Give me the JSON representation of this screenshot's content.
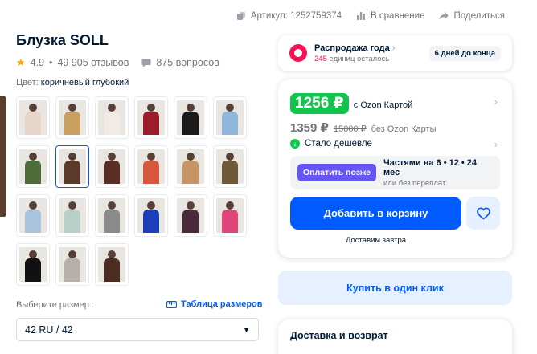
{
  "topbar": {
    "article": "Артикул: 1252759374",
    "compare": "В сравнение",
    "share": "Поделиться"
  },
  "product": {
    "title": "Блузка SOLL",
    "rating": "4.9",
    "reviews": "49 905 отзывов",
    "questions": "875 вопросов",
    "color_label": "Цвет:",
    "color_value": "коричневый глубокий"
  },
  "thumbnails": [
    {
      "name": "variant-1",
      "color": "#e6d5c8"
    },
    {
      "name": "variant-2",
      "color": "#c9a060"
    },
    {
      "name": "variant-3",
      "color": "#f0ebe4"
    },
    {
      "name": "variant-4",
      "color": "#9c1c2c"
    },
    {
      "name": "variant-5",
      "color": "#1a1a1a"
    },
    {
      "name": "variant-6",
      "color": "#8fb8dc"
    },
    {
      "name": "variant-7",
      "color": "#4e6b3a"
    },
    {
      "name": "variant-8",
      "color": "#5a3a2a"
    },
    {
      "name": "variant-9",
      "color": "#5a2e24"
    },
    {
      "name": "variant-10",
      "color": "#d4573e"
    },
    {
      "name": "variant-11",
      "color": "#c79565"
    },
    {
      "name": "variant-12",
      "color": "#6e5a3a"
    },
    {
      "name": "variant-13",
      "color": "#a9c4df"
    },
    {
      "name": "variant-14",
      "color": "#b8d0c8"
    },
    {
      "name": "variant-15",
      "color": "#8a8a8a"
    },
    {
      "name": "variant-16",
      "color": "#1b3fb8"
    },
    {
      "name": "variant-17",
      "color": "#4a2a3a"
    },
    {
      "name": "variant-18",
      "color": "#e0457a"
    },
    {
      "name": "variant-19",
      "color": "#111111"
    },
    {
      "name": "variant-20",
      "color": "#b5b0ac"
    },
    {
      "name": "variant-21",
      "color": "#4a2c20"
    }
  ],
  "selected_thumbnail_index": 7,
  "size": {
    "label": "Выберите размер:",
    "table_link": "Таблица размеров",
    "selected": "42 RU / 42"
  },
  "sale": {
    "title": "Распродажа года",
    "remaining_count": "245",
    "remaining_text": "единиц осталось",
    "days_badge": "6 дней до конца"
  },
  "price": {
    "card_price": "1256 ₽",
    "card_note": "с Ozon Картой",
    "regular_price": "1359 ₽",
    "old_price": "15000 ₽",
    "without_card": "без Ozon Карты",
    "cheaper_text": "Стало дешевле",
    "pay_later_label": "Оплатить позже",
    "installment_title": "Частями на 6 • 12 • 24 мес",
    "installment_note": "или без переплат",
    "add_to_cart": "Добавить в корзину",
    "delivery_note": "Доставим завтра"
  },
  "one_click": "Купить в один клик",
  "delivery_section": {
    "title": "Доставка и возврат"
  },
  "colors": {
    "accent": "#005bff",
    "green": "#10c44c",
    "sale_pink": "#f91155",
    "pay_later_purple": "#6655f3"
  }
}
